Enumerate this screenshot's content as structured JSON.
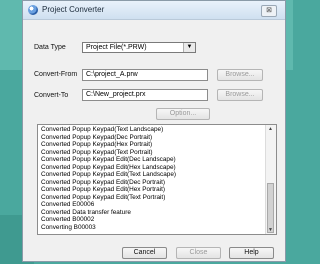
{
  "window": {
    "title": "Project Converter",
    "close_label": "⊠"
  },
  "data_type": {
    "label": "Data Type",
    "selected": "Project File(*.PRW)"
  },
  "convert_from": {
    "label": "Convert-From",
    "value": "C:\\project_A.prw",
    "browse_label": "Browse..."
  },
  "convert_to": {
    "label": "Convert-To",
    "value": "C:\\New_project.prx",
    "browse_label": "Browse..."
  },
  "option_label": "Option...",
  "log": [
    "Converted Popup Keypad(Text Landscape)",
    "Converted Popup Keypad(Dec Portrait)",
    "Converted Popup Keypad(Hex Portrait)",
    "Converted Popup Keypad(Text Portrait)",
    "Converted Popup Keypad Edit(Dec Landscape)",
    "Converted Popup Keypad Edit(Hex Landscape)",
    "Converted Popup Keypad Edit(Text Landscape)",
    "Converted Popup Keypad Edit(Dec Portrait)",
    "Converted Popup Keypad Edit(Hex Portrait)",
    "Converted Popup Keypad Edit(Text Portrait)",
    "Converted E00006",
    "Converted Data transfer feature",
    "Converted B00002",
    "Converting B00003"
  ],
  "buttons": {
    "cancel": "Cancel",
    "close": "Close",
    "help": "Help"
  }
}
